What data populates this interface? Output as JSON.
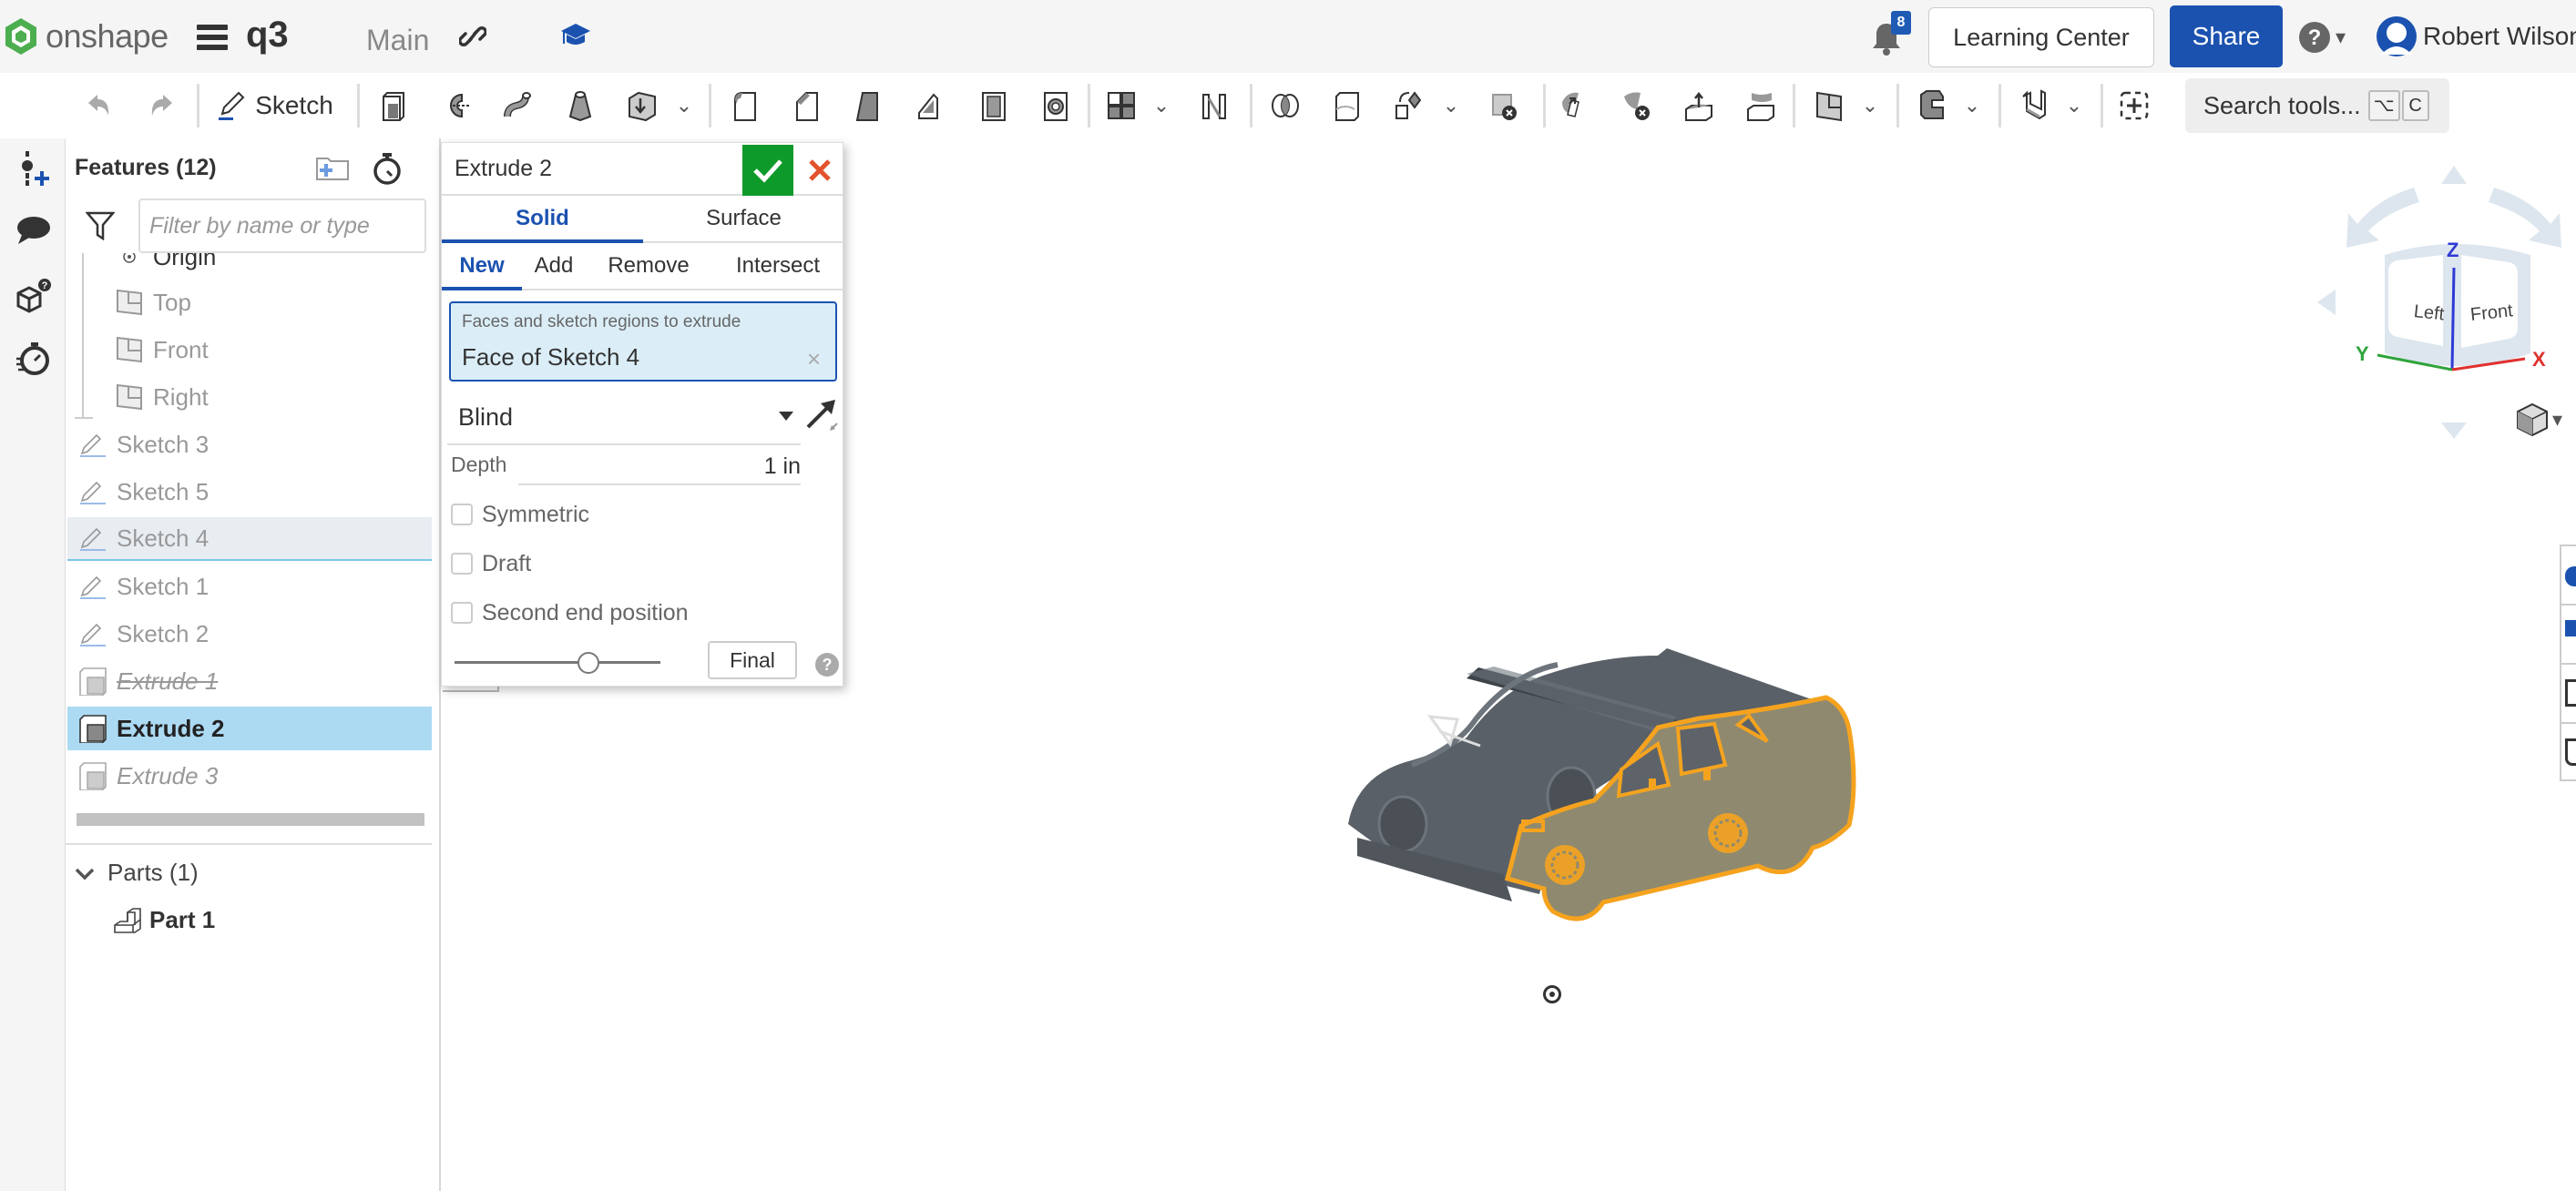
{
  "header": {
    "brand": "onshape",
    "document_title": "q3",
    "branch": "Main",
    "notifications_count": "8",
    "learning_center_label": "Learning Center",
    "share_label": "Share",
    "user_name": "Robert Wilson",
    "brand_color": "#4cae4f",
    "accent_color": "#1b52b0"
  },
  "toolbar": {
    "sketch_label": "Sketch",
    "search_placeholder": "Search tools...",
    "search_shortcut": [
      "⌥",
      "C"
    ],
    "tools": [
      "undo",
      "redo",
      "sketch",
      "extrude",
      "revolve",
      "sweep",
      "loft",
      "thicken",
      "fillet",
      "chamfer",
      "draft",
      "rib",
      "shell",
      "hole",
      "linear-pattern",
      "mirror",
      "boolean",
      "split",
      "transform",
      "delete-part",
      "move-face",
      "delete-face",
      "offset-surface",
      "replace-face",
      "plane",
      "sheet-metal",
      "frame",
      "add-custom-feature"
    ]
  },
  "rail": {
    "items": [
      "feature-list",
      "insert-feature",
      "comments",
      "configurations",
      "variable-studio"
    ]
  },
  "feature_panel": {
    "title": "Features (12)",
    "filter_placeholder": "Filter by name or type",
    "items": [
      {
        "label": "Origin",
        "type": "origin",
        "state": "default"
      },
      {
        "label": "Top",
        "type": "plane",
        "state": "default"
      },
      {
        "label": "Front",
        "type": "plane",
        "state": "default"
      },
      {
        "label": "Right",
        "type": "plane",
        "state": "default"
      },
      {
        "label": "Sketch 3",
        "type": "sketch",
        "state": "default"
      },
      {
        "label": "Sketch 5",
        "type": "sketch",
        "state": "default"
      },
      {
        "label": "Sketch 4",
        "type": "sketch",
        "state": "hover"
      },
      {
        "label": "Sketch 1",
        "type": "sketch",
        "state": "default"
      },
      {
        "label": "Sketch 2",
        "type": "sketch",
        "state": "default"
      },
      {
        "label": "Extrude 1",
        "type": "extrude",
        "state": "suppressed"
      },
      {
        "label": "Extrude 2",
        "type": "extrude",
        "state": "selected"
      },
      {
        "label": "Extrude 3",
        "type": "extrude",
        "state": "rolled-back"
      }
    ],
    "parts_label": "Parts (1)",
    "parts": [
      {
        "label": "Part 1"
      }
    ]
  },
  "extrude_dialog": {
    "title": "Extrude 2",
    "body_type_tabs": [
      {
        "label": "Solid",
        "active": true
      },
      {
        "label": "Surface",
        "active": false
      }
    ],
    "operation_tabs": [
      {
        "label": "New",
        "active": true
      },
      {
        "label": "Add",
        "active": false
      },
      {
        "label": "Remove",
        "active": false
      },
      {
        "label": "Intersect",
        "active": false
      }
    ],
    "selection_label": "Faces and sketch regions to extrude",
    "selection_value": "Face of Sketch 4",
    "end_type": "Blind",
    "depth_label": "Depth",
    "depth_value": "1 in",
    "checkboxes": [
      {
        "label": "Symmetric",
        "checked": false
      },
      {
        "label": "Draft",
        "checked": false
      },
      {
        "label": "Second end position",
        "checked": false
      }
    ],
    "rollback_slider_fraction": 0.65,
    "final_label": "Final",
    "ok_color": "#0e9a2a",
    "cancel_color": "#e2532d"
  },
  "viewcube": {
    "faces": [
      "Left",
      "Front"
    ],
    "axes": {
      "x": "X",
      "y": "Y",
      "z": "Z"
    },
    "axis_colors": {
      "x": "#e0312f",
      "y": "#2fa43b",
      "z": "#2f3ad6"
    }
  },
  "viewport": {
    "highlight_color": "#f5a31f"
  }
}
